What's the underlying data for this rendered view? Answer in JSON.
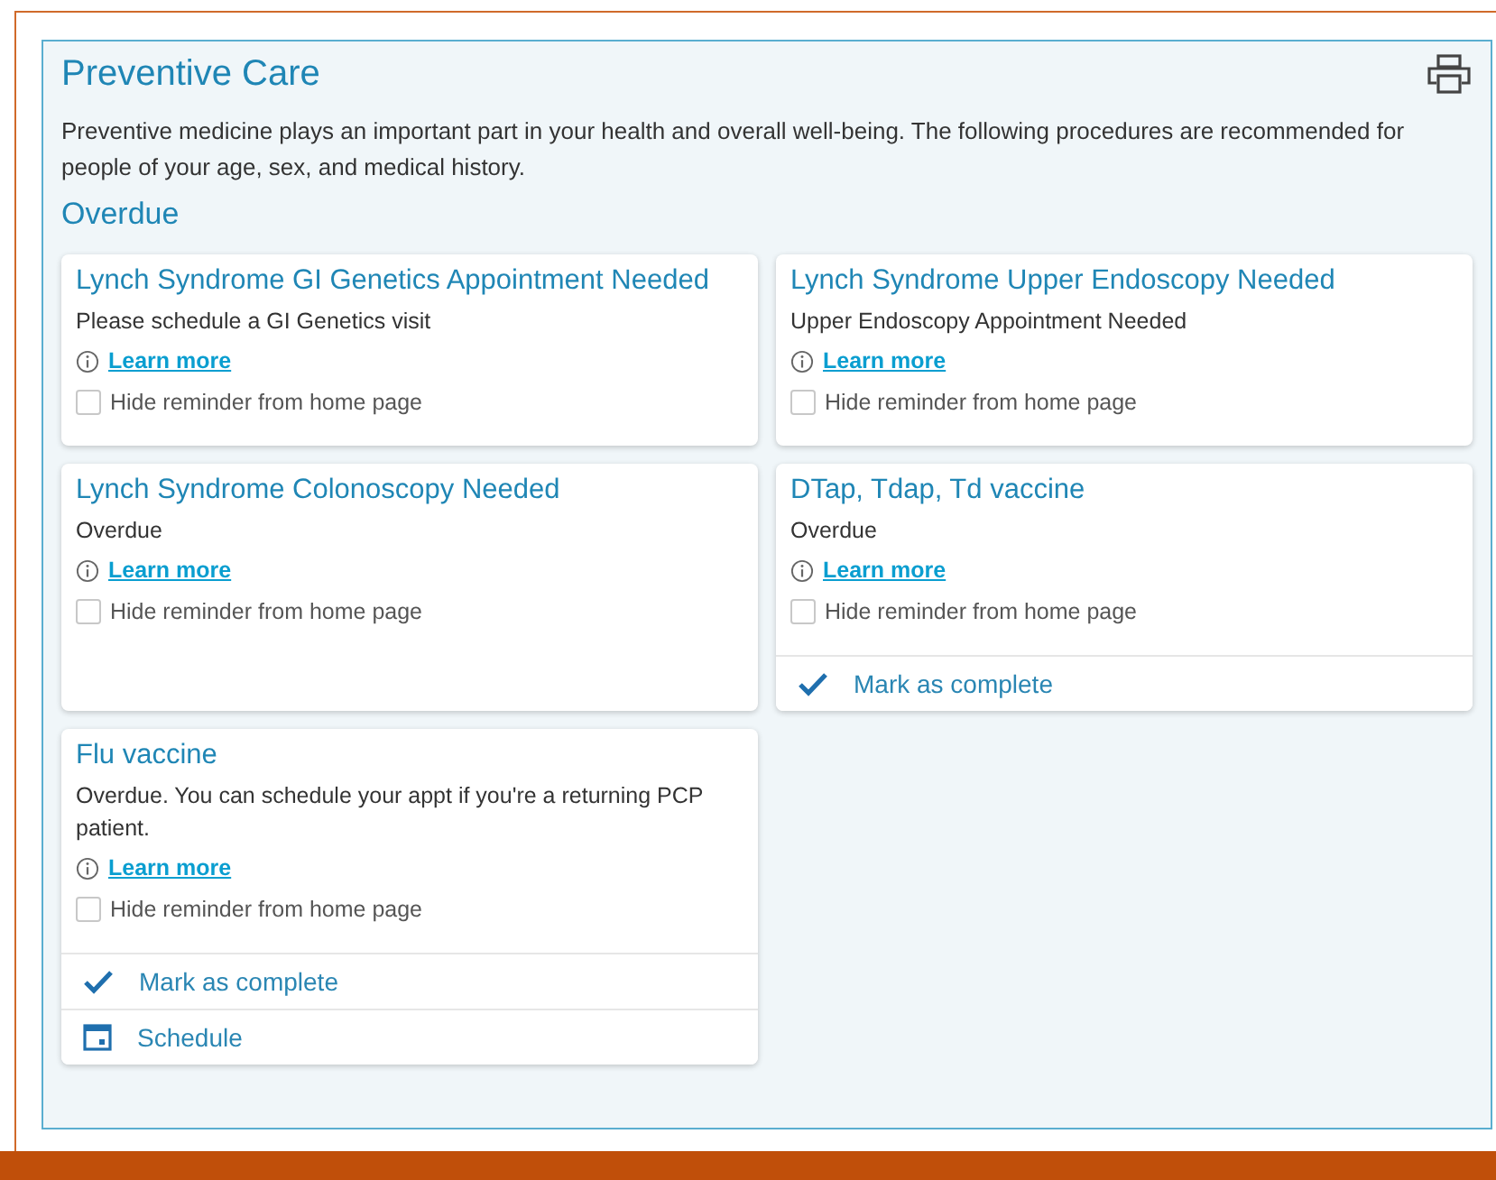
{
  "panel": {
    "title": "Preventive Care",
    "intro": "Preventive medicine plays an important part in your health and overall well-being. The following procedures are recommended for people of your age, sex, and medical history.",
    "section": "Overdue"
  },
  "cards": [
    {
      "title": "Lynch Syndrome GI Genetics Appointment Needed",
      "status": "Please schedule a GI Genetics visit",
      "link": "Learn more",
      "hide_label": "Hide reminder from home page",
      "hide_checked": false
    },
    {
      "title": "Lynch Syndrome Upper Endoscopy Needed",
      "status": "Upper Endoscopy Appointment Needed",
      "link": "Learn more",
      "hide_label": "Hide reminder from home page",
      "hide_checked": false
    },
    {
      "title": "Lynch Syndrome Colonoscopy Needed",
      "status": "Overdue",
      "link": "Learn more",
      "hide_label": "Hide reminder from home page",
      "hide_checked": false
    },
    {
      "title": "DTap, Tdap, Td vaccine",
      "status": "Overdue",
      "link": "Learn more",
      "hide_label": "Hide reminder from home page",
      "hide_checked": false,
      "actions": [
        {
          "kind": "complete",
          "label": "Mark as complete"
        }
      ]
    },
    {
      "title": "Flu vaccine",
      "status": "Overdue. You can schedule your appt if you're a returning PCP patient.",
      "link": "Learn more",
      "hide_label": "Hide reminder from home page",
      "hide_checked": false,
      "actions": [
        {
          "kind": "complete",
          "label": "Mark as complete"
        },
        {
          "kind": "schedule",
          "label": "Schedule"
        }
      ]
    }
  ]
}
